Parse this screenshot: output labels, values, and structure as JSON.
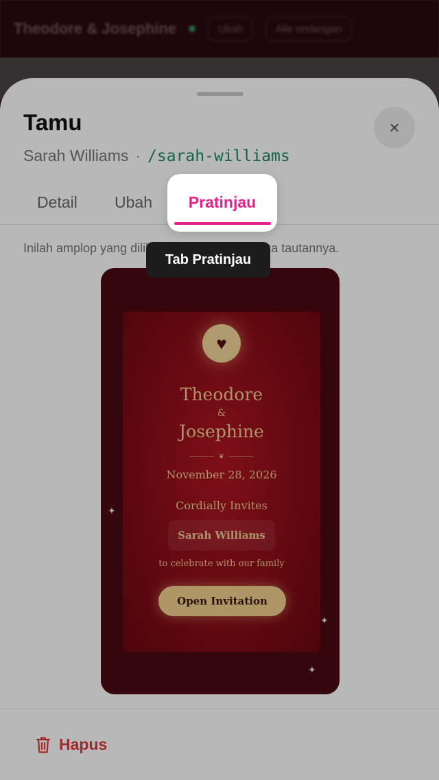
{
  "background": {
    "app_title": "Theodore & Josephine",
    "edit_label": "Ubah",
    "all_guests_label": "Alle ondangan"
  },
  "sheet": {
    "title": "Tamu",
    "guest_name": "Sarah Williams",
    "separator": "·",
    "slug": "/sarah-williams",
    "close_icon": "×",
    "tabs": [
      {
        "label": "Detail"
      },
      {
        "label": "Ubah"
      },
      {
        "label": "Pratinjau",
        "active": true
      }
    ],
    "info_text": "Inilah amplop yang dilihat tamu saat membuka tautannya.",
    "delete_label": "Hapus"
  },
  "preview": {
    "heart_icon": "♥",
    "name1": "Theodore",
    "ampersand": "&",
    "name2": "Josephine",
    "ornament": "❦",
    "date": "November 28, 2026",
    "invites": "Cordially Invites",
    "guest": "Sarah Williams",
    "celebrate": "to celebrate with our family",
    "open_button": "Open Invitation"
  },
  "tooltip": {
    "text": "Tab Pratinjau"
  },
  "colors": {
    "accent": "#e8208a",
    "slug": "#1e8a5c",
    "danger": "#e03a3a",
    "card_red": "#8a0d18",
    "gold": "#f0cf92"
  }
}
